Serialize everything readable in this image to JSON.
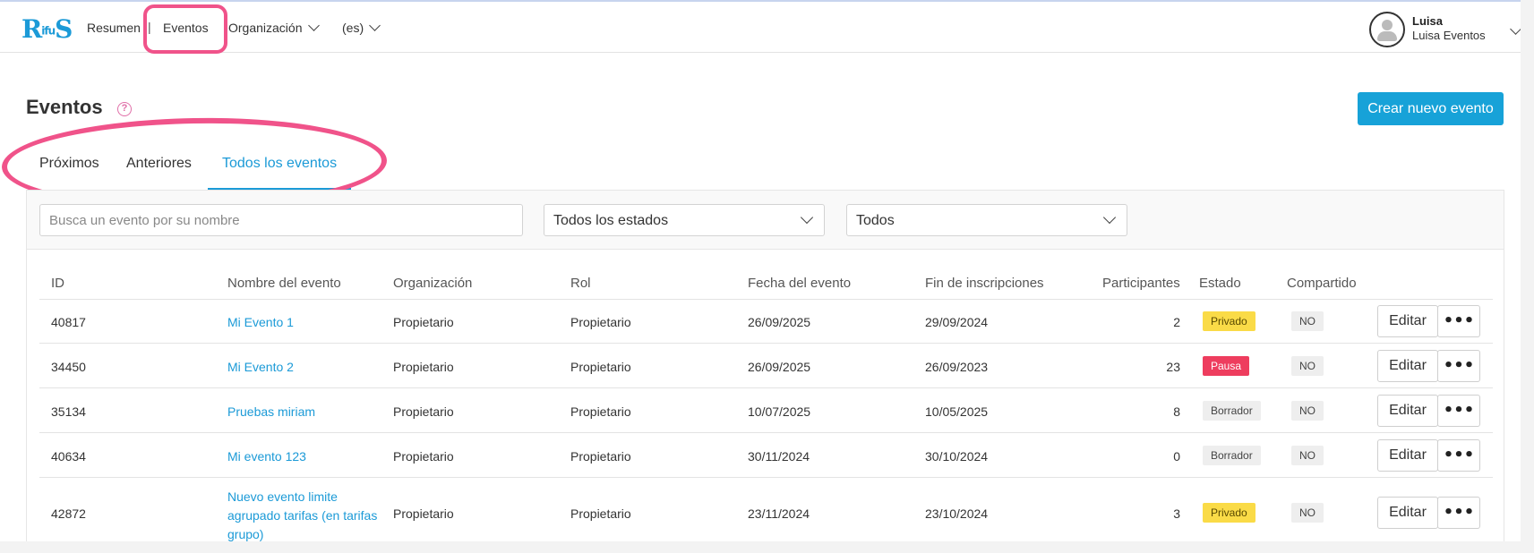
{
  "header": {
    "logo": {
      "left": "R",
      "mid": "ifu",
      "right": "S"
    },
    "nav": {
      "resumen": "Resumen",
      "separator": "|",
      "eventos": "Eventos",
      "organizacion": "Organización",
      "language": "(es)"
    },
    "user": {
      "name": "Luisa",
      "org": "Luisa Eventos"
    }
  },
  "page": {
    "title": "Eventos",
    "help": "?",
    "create_button": "Crear nuevo evento"
  },
  "tabs": [
    "Próximos",
    "Anteriores",
    "Todos los eventos"
  ],
  "filters": {
    "search_placeholder": "Busca un evento por su nombre",
    "status_select": "Todos los estados",
    "type_select": "Todos"
  },
  "table": {
    "columns": [
      "ID",
      "Nombre del evento",
      "Organización",
      "Rol",
      "Fecha del evento",
      "Fin de inscripciones",
      "Participantes",
      "Estado",
      "Compartido"
    ],
    "edit_label": "Editar",
    "more_label": "•••",
    "rows": [
      {
        "id": "40817",
        "name": "Mi Evento 1",
        "org": "Propietario",
        "rol": "Propietario",
        "fecha": "26/09/2025",
        "fin": "29/09/2024",
        "participantes": "2",
        "estado": "Privado",
        "compartido": "NO"
      },
      {
        "id": "34450",
        "name": "Mi Evento 2",
        "org": "Propietario",
        "rol": "Propietario",
        "fecha": "26/09/2025",
        "fin": "26/09/2023",
        "participantes": "23",
        "estado": "Pausa",
        "compartido": "NO"
      },
      {
        "id": "35134",
        "name": "Pruebas miriam",
        "org": "Propietario",
        "rol": "Propietario",
        "fecha": "10/07/2025",
        "fin": "10/05/2025",
        "participantes": "8",
        "estado": "Borrador",
        "compartido": "NO"
      },
      {
        "id": "40634",
        "name": "Mi evento 123",
        "org": "Propietario",
        "rol": "Propietario",
        "fecha": "30/11/2024",
        "fin": "30/10/2024",
        "participantes": "0",
        "estado": "Borrador",
        "compartido": "NO"
      },
      {
        "id": "42872",
        "name": "Nuevo evento limite agrupado tarifas (en tarifas grupo)",
        "name_lines": [
          "Nuevo evento limite",
          "agrupado tarifas (en tarifas",
          "grupo)"
        ],
        "org": "Propietario",
        "rol": "Propietario",
        "fecha": "23/11/2024",
        "fin": "23/10/2024",
        "participantes": "3",
        "estado": "Privado",
        "compartido": "NO"
      }
    ]
  },
  "colors": {
    "accent": "#1b9ad7",
    "annotation": "#f0538a",
    "badge_privado": "#fadb47",
    "badge_pausa": "#ee3d5e",
    "badge_borrador": "#eeeeee"
  }
}
